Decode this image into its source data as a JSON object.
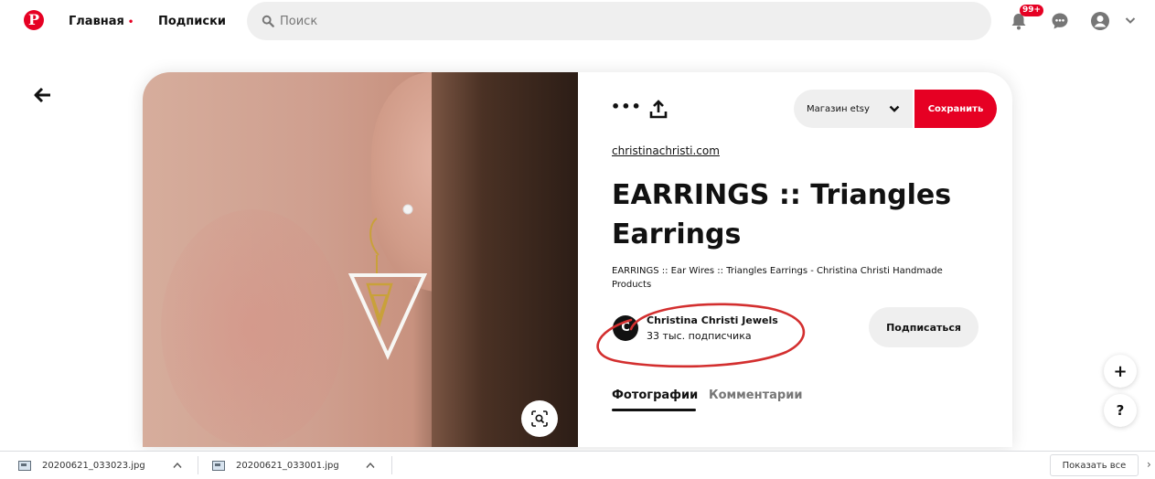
{
  "header": {
    "logo": "P",
    "nav_home": "Главная",
    "nav_home_dot": "•",
    "nav_subscriptions": "Подписки",
    "search_placeholder": "Поиск",
    "notification_badge": "99+",
    "icons": [
      "pinterest-logo-icon",
      "search-icon",
      "bell-icon",
      "chat-icon",
      "user-avatar-icon",
      "chevron-down-icon"
    ]
  },
  "pin": {
    "menu_dots": "•••",
    "board_select": "Магазин etsy",
    "save_button": "Сохранить",
    "source_link": "christinachristi.com",
    "title": "EARRINGS :: Triangles Earrings",
    "description": "EARRINGS :: Ear Wires :: Triangles Earrings - Christina Christi Handmade Products",
    "creator": {
      "initial": "C",
      "name": "Christina Christi Jewels",
      "followers": "33 тыс. подписчика"
    },
    "follow_button": "Подписаться",
    "tabs": [
      "Фотографии",
      "Комментарии"
    ]
  },
  "floating": {
    "plus": "+",
    "help": "?"
  },
  "downloads": {
    "items": [
      "20200621_033023.jpg",
      "20200621_033001.jpg"
    ],
    "show_all": "Показать все",
    "close": "›"
  },
  "colors": {
    "accent": "#e60023",
    "annotation": "#d32f2f",
    "pill_bg": "#efefef"
  }
}
